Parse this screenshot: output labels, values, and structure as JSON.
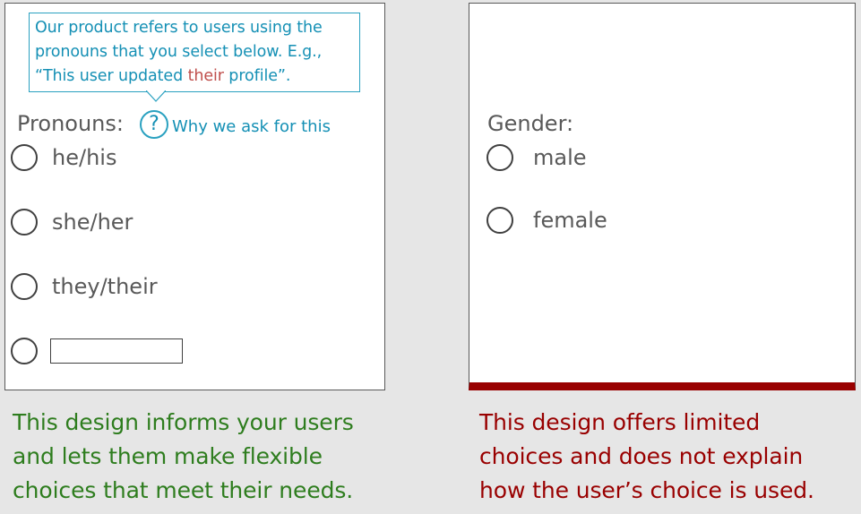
{
  "good_design": {
    "tooltip": {
      "text_before": "Our product refers to users using the pronouns that you select below. E.g., “This user updated ",
      "highlight": "their",
      "text_after": " profile”."
    },
    "label": "Pronouns:",
    "help_icon_glyph": "?",
    "help_link": "Why we ask for this",
    "options": [
      "he/his",
      "she/her",
      "they/their"
    ],
    "other_input_value": "",
    "caption_lines": [
      "This design informs your users",
      "and lets them make flexible",
      "choices that meet their needs."
    ]
  },
  "bad_design": {
    "label": "Gender:",
    "options": [
      "male",
      "female"
    ],
    "caption_lines": [
      "This design offers limited",
      "choices and does not explain",
      "how the user’s choice is used."
    ]
  },
  "colors": {
    "background": "#e6e6e6",
    "tooltip_blue": "#1590b5",
    "highlight_red": "#c0504d",
    "good_green": "#2e7d1e",
    "bad_red": "#990000",
    "label_gray": "#595959"
  },
  "icons": {
    "help": "question-circle-icon",
    "tooltip_pointer": "speech-tail-icon"
  }
}
